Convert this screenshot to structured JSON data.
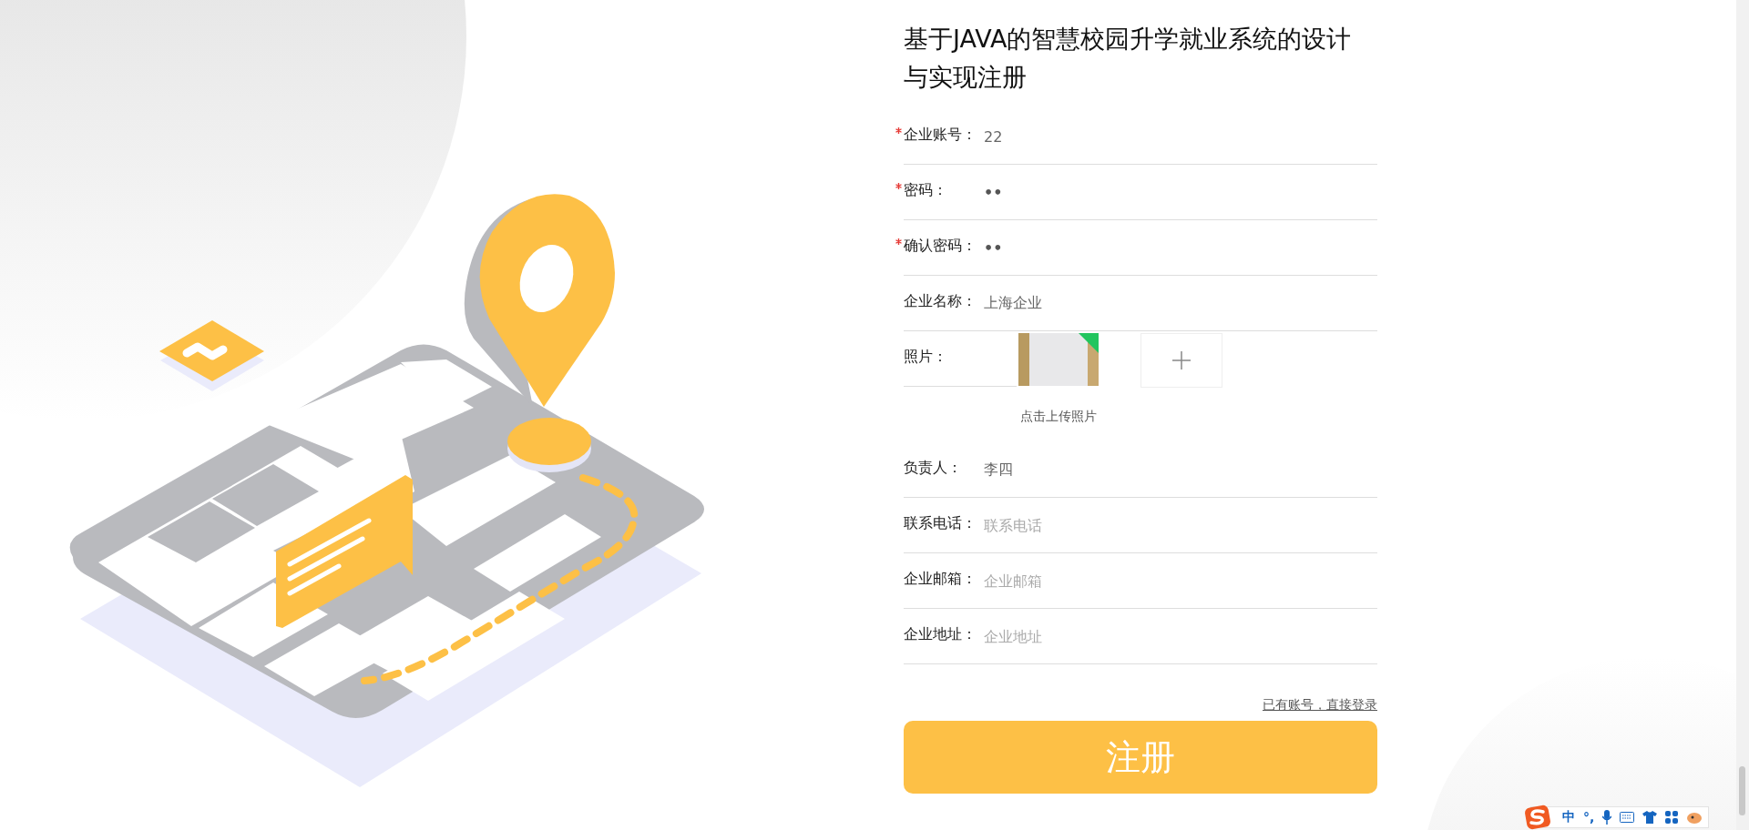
{
  "title": "基于JAVA的智慧校园升学就业系统的设计与实现注册",
  "fields": [
    {
      "kind": "text",
      "label": "企业账号：",
      "required": true,
      "value": "22"
    },
    {
      "kind": "password",
      "label": "密码：",
      "required": true,
      "value": "••"
    },
    {
      "kind": "password",
      "label": "确认密码：",
      "required": true,
      "value": "••"
    },
    {
      "kind": "text",
      "label": "企业名称：",
      "required": false,
      "value": "上海企业"
    },
    {
      "kind": "upload",
      "label": "照片：",
      "required": false,
      "hint": "点击上传照片"
    },
    {
      "kind": "text",
      "label": "负责人：",
      "required": false,
      "value": "李四"
    },
    {
      "kind": "text",
      "label": "联系电话：",
      "required": false,
      "placeholder": "联系电话"
    },
    {
      "kind": "text",
      "label": "企业邮箱：",
      "required": false,
      "placeholder": "企业邮箱"
    },
    {
      "kind": "text",
      "label": "企业地址：",
      "required": false,
      "placeholder": "企业地址"
    }
  ],
  "login_link": "已有账号，直接登录",
  "submit": "注册",
  "ime": {
    "mode": "中",
    "punctuation": "°,"
  }
}
